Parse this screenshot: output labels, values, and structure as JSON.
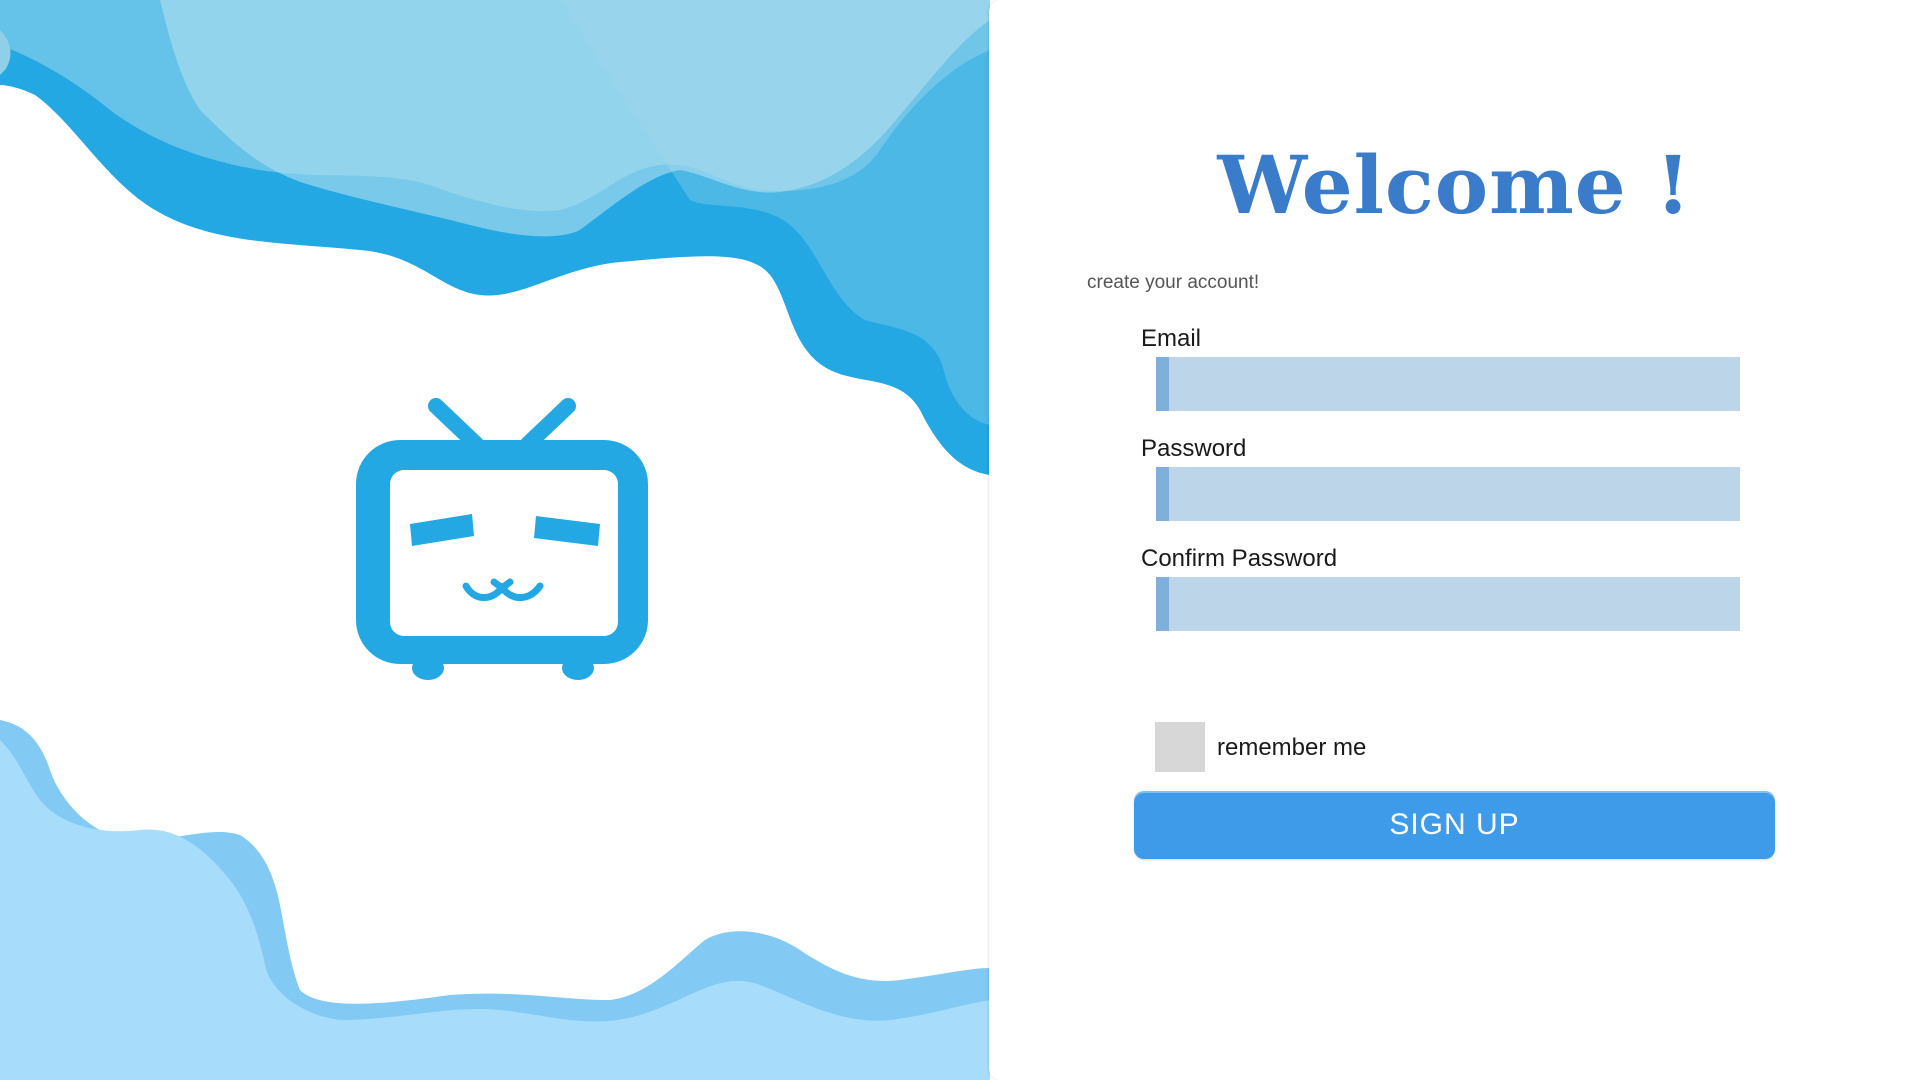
{
  "brand": {
    "logo_icon": "bilibili-tv-icon",
    "accent_color": "#23a8e3",
    "wave_colors": [
      "#23a8e3",
      "#4cb8e6",
      "#8fd0e8",
      "#a8dcfb",
      "#82c9f4"
    ]
  },
  "form": {
    "title": "Welcome !",
    "subtitle": "create your account!",
    "fields": {
      "email": {
        "label": "Email",
        "value": "",
        "placeholder": ""
      },
      "password": {
        "label": "Password",
        "value": "",
        "placeholder": ""
      },
      "confirm_password": {
        "label": "Confirm Password",
        "value": "",
        "placeholder": ""
      }
    },
    "remember_me": {
      "label": "remember me",
      "checked": false
    },
    "submit_label": "SIGN UP",
    "colors": {
      "title": "#3a7cca",
      "input_bg": "#bdd5e8",
      "input_accent": "#7fb0dc",
      "button_bg": "#3d9bea",
      "checkbox_bg": "#d7d7d7"
    }
  }
}
